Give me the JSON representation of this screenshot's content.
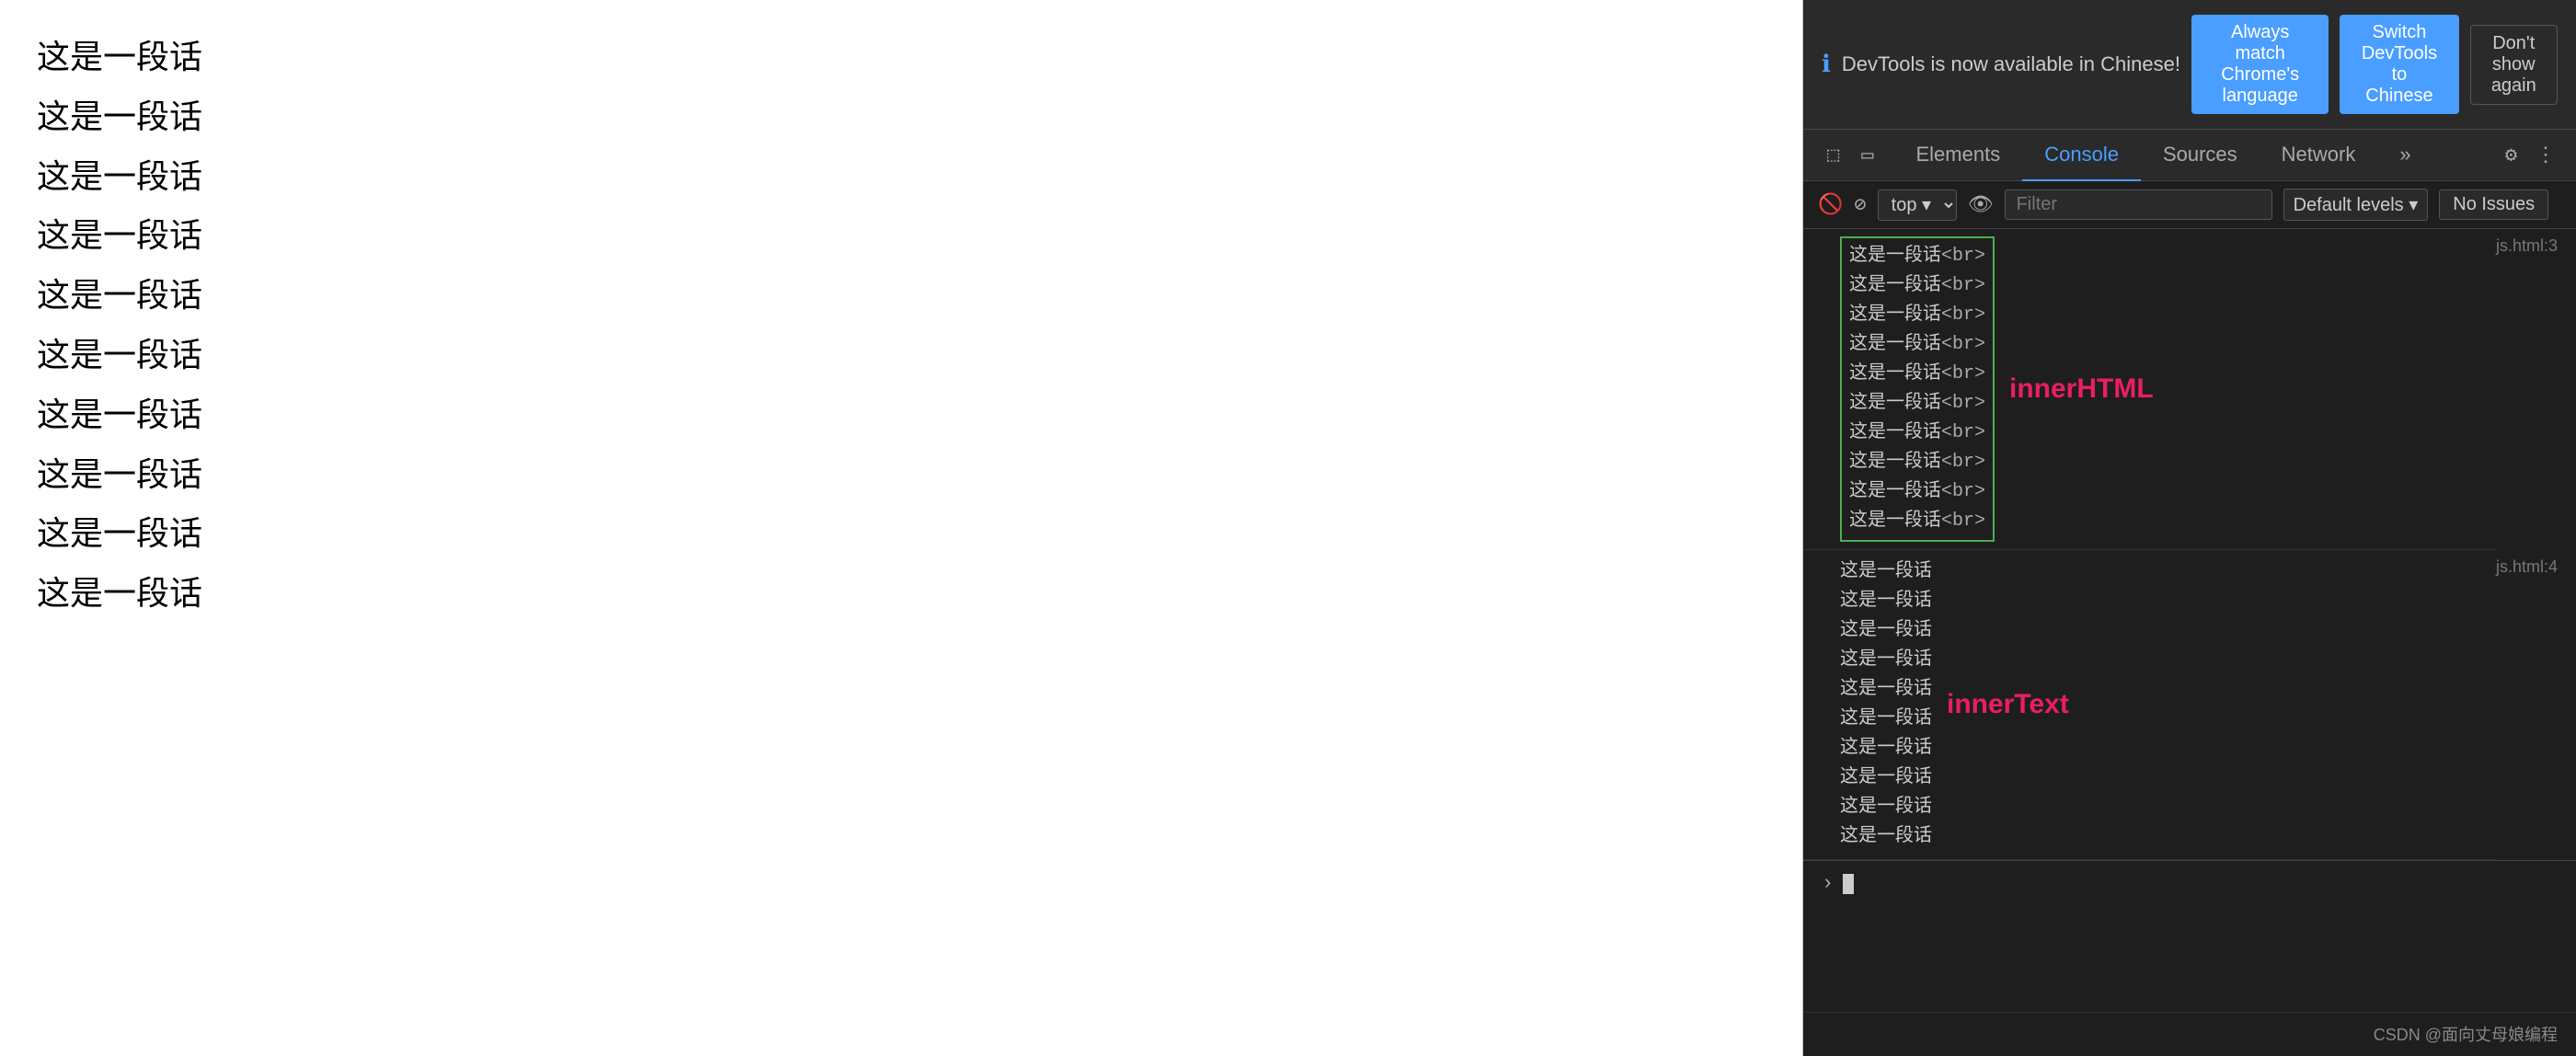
{
  "browser": {
    "content_lines": [
      "这是一段话",
      "这是一段话",
      "这是一段话",
      "这是一段话",
      "这是一段话",
      "这是一段话",
      "这是一段话",
      "这是一段话",
      "这是一段话",
      "这是一段话"
    ]
  },
  "devtools": {
    "notification": {
      "icon": "ℹ",
      "text": "DevTools is now available in Chinese!",
      "btn_match": "Always match Chrome's language",
      "btn_switch": "Switch DevTools to Chinese",
      "btn_dont_show": "Don't show again"
    },
    "tabs": [
      {
        "label": "Elements",
        "active": false
      },
      {
        "label": "Console",
        "active": true
      },
      {
        "label": "Sources",
        "active": false
      },
      {
        "label": "Network",
        "active": false
      },
      {
        "label": "»",
        "active": false
      }
    ],
    "filter": {
      "top_label": "top ▾",
      "filter_placeholder": "Filter",
      "default_levels": "Default levels ▾",
      "no_issues": "No Issues"
    },
    "console": {
      "innerHTML_source": "js.html:3",
      "innerText_source": "js.html:4",
      "html_lines": [
        "这是一段话<br>",
        "这是一段话<br>",
        "这是一段话<br>",
        "这是一段话<br>",
        "这是一段话<br>",
        "这是一段话<br>",
        "这是一段话<br>",
        "这是一段话<br>",
        "这是一段话<br>",
        "这是一段话<br>"
      ],
      "innerHTML_label": "innerHTML",
      "text_lines": [
        "这是一段话",
        "这是一段话",
        "这是一段话",
        "这是一段话",
        "这是一段话",
        "这是一段话",
        "这是一段话",
        "这是一段话",
        "这是一段话",
        "这是一段话"
      ],
      "innerText_label": "innerText"
    },
    "footer": {
      "text": "CSDN @面向丈母娘编程"
    }
  }
}
